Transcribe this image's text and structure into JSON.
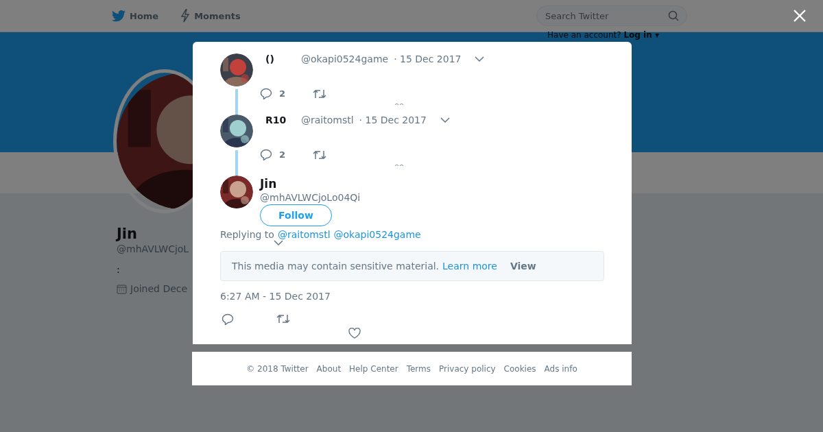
{
  "nav": {
    "items": [
      {
        "kind": "bird",
        "label": "Home"
      },
      {
        "kind": "bolt",
        "label": "Moments"
      }
    ],
    "search": {
      "placeholder": "Search Twitter"
    },
    "login": {
      "prompt": "Have an account?",
      "link": "Log in ▾"
    }
  },
  "profile": {
    "name": "Jin",
    "handle": "@mhAVLWCjoL",
    "bio": ":",
    "joined": "Joined Dece"
  },
  "thread": [
    {
      "name": "()",
      "handle": "@okapi0524game",
      "date": "· 15 Dec 2017",
      "replies": "2"
    },
    {
      "name": "R10",
      "handle": "@raitomstl",
      "date": "· 15 Dec 2017",
      "replies": "2"
    }
  ],
  "tweet": {
    "name": "Jin",
    "handle": "@mhAVLWCjoLo04Qi",
    "follow": "Follow",
    "replying_label": "Replying to",
    "replying_to": [
      "@raitomstl",
      "@okapi0524game"
    ],
    "sensitive": {
      "text": "This media may contain sensitive material.",
      "link": "Learn more",
      "button": "View"
    },
    "timestamp": "6:27 AM - 15 Dec 2017"
  },
  "footer": [
    "© 2018 Twitter",
    "About",
    "Help Center",
    "Terms",
    "Privacy policy",
    "Cookies",
    "Ads info"
  ]
}
